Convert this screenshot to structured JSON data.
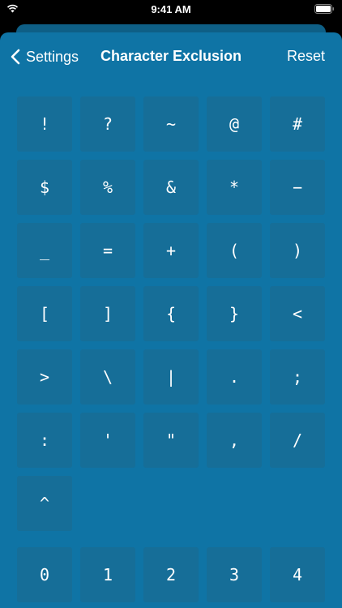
{
  "status": {
    "time": "9:41 AM"
  },
  "nav": {
    "back_label": "Settings",
    "title": "Character Exclusion",
    "reset_label": "Reset"
  },
  "symbols": [
    "!",
    "?",
    "~",
    "@",
    "#",
    "$",
    "%",
    "&",
    "*",
    "−",
    "_",
    "=",
    "+",
    "(",
    ")",
    "[",
    "]",
    "{",
    "}",
    "<",
    ">",
    "\\",
    "|",
    ".",
    ";",
    ":",
    "'",
    "\"",
    ",",
    "/",
    "^"
  ],
  "digits": [
    "0",
    "1",
    "2",
    "3",
    "4"
  ]
}
